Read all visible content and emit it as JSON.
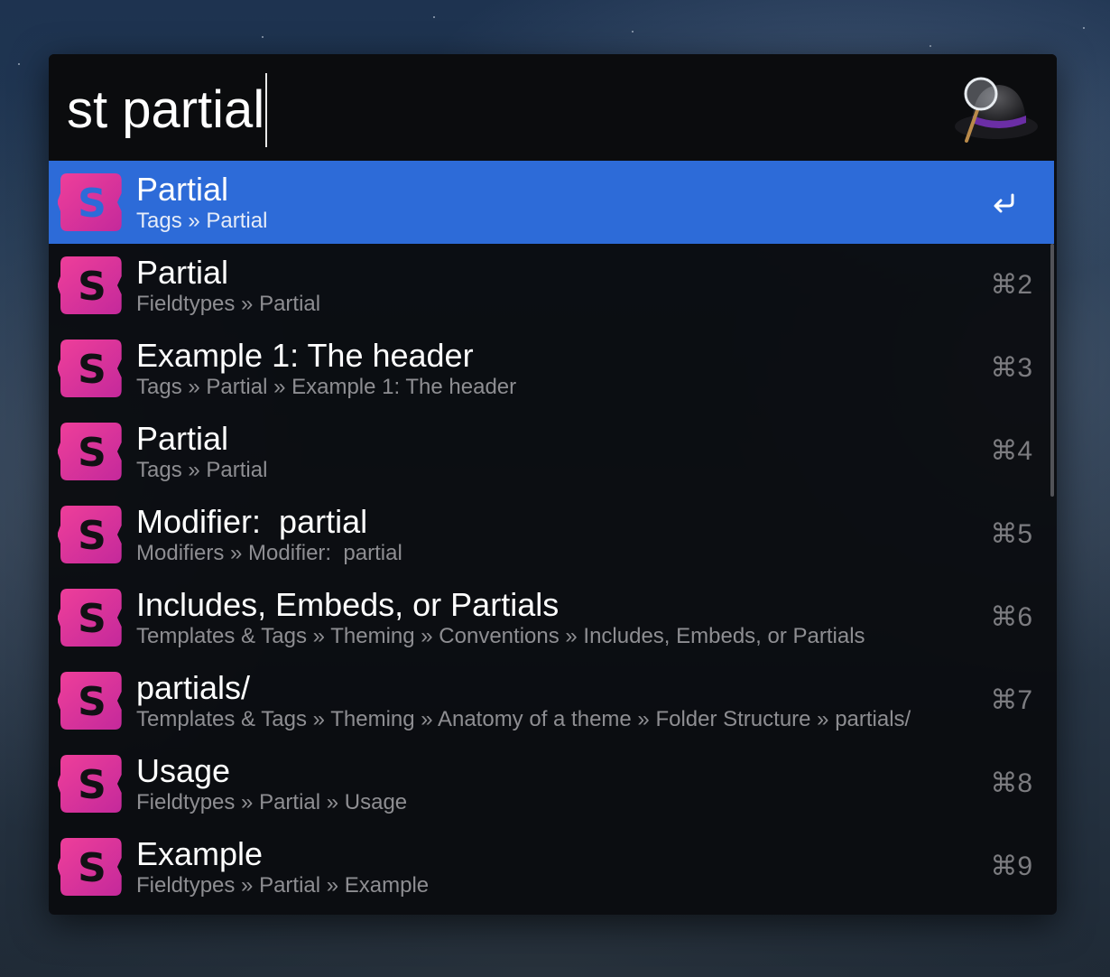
{
  "search": {
    "query": "st partial"
  },
  "colors": {
    "selection": "#2d6bd8",
    "icon_gradient_start": "#e8399a",
    "icon_gradient_end": "#c2319a"
  },
  "results": [
    {
      "title": "Partial",
      "subtitle": "Tags » Partial",
      "shortcut": "",
      "selected": true
    },
    {
      "title": "Partial",
      "subtitle": "Fieldtypes » Partial",
      "shortcut": "⌘2"
    },
    {
      "title": "Example 1: The header",
      "subtitle": "Tags » Partial » Example 1: The header",
      "shortcut": "⌘3"
    },
    {
      "title": "Partial",
      "subtitle": "Tags » Partial",
      "shortcut": "⌘4"
    },
    {
      "title": "Modifier:  partial",
      "subtitle": "Modifiers » Modifier:  partial",
      "shortcut": "⌘5"
    },
    {
      "title": "Includes, Embeds, or Partials",
      "subtitle": "Templates & Tags » Theming » Conventions » Includes, Embeds, or Partials",
      "shortcut": "⌘6"
    },
    {
      "title": "partials/",
      "subtitle": "Templates & Tags » Theming » Anatomy of a theme » Folder Structure » partials/",
      "shortcut": "⌘7"
    },
    {
      "title": "Usage",
      "subtitle": "Fieldtypes » Partial » Usage",
      "shortcut": "⌘8"
    },
    {
      "title": "Example",
      "subtitle": "Fieldtypes » Partial » Example",
      "shortcut": "⌘9"
    }
  ],
  "icons": {
    "app_icon": "statamic-s-icon",
    "logo": "alfred-hat-icon",
    "action": "return-icon"
  },
  "app_icon_letter": "S"
}
